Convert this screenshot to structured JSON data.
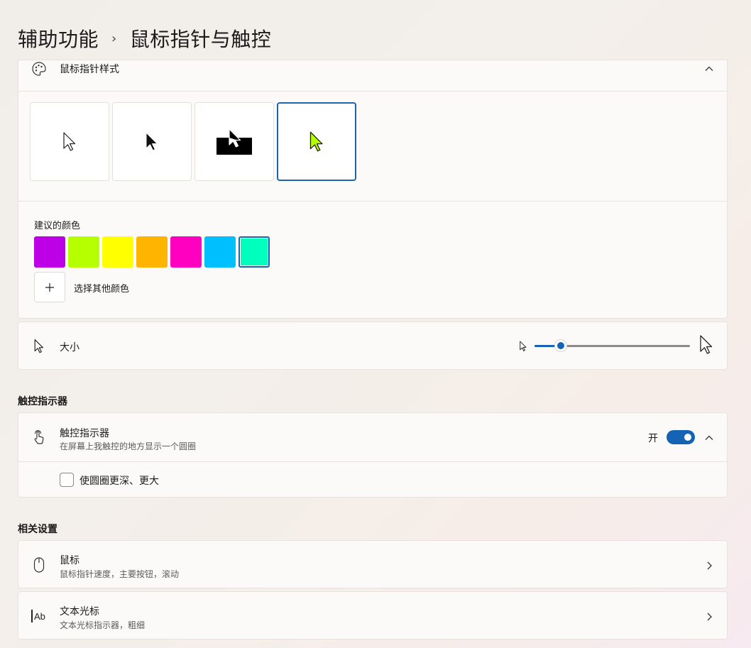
{
  "breadcrumb": {
    "parent": "辅助功能",
    "separator": "›",
    "current": "鼠标指针与触控"
  },
  "pointer_style": {
    "title": "鼠标指针样式",
    "styles": [
      "white",
      "black",
      "inverted",
      "custom"
    ],
    "selected_style": "custom",
    "custom_color": "#b6ff00"
  },
  "colors": {
    "label": "建议的颜色",
    "swatches": [
      "#bd00e6",
      "#b6ff00",
      "#ffff00",
      "#ffb400",
      "#ff00c1",
      "#00bfff",
      "#00ffbd"
    ],
    "selected_index": 6,
    "other_label": "选择其他颜色"
  },
  "size": {
    "title": "大小",
    "value_fraction": 0.17
  },
  "touch_section_heading": "触控指示器",
  "touch": {
    "title": "触控指示器",
    "subtitle": "在屏幕上我触控的地方显示一个圆圈",
    "state_label": "开",
    "on": true,
    "checkbox_label": "使圆圈更深、更大",
    "checkbox_checked": false
  },
  "related_heading": "相关设置",
  "related": [
    {
      "title": "鼠标",
      "subtitle": "鼠标指针速度，主要按钮，滚动",
      "icon": "mouse-icon"
    },
    {
      "title": "文本光标",
      "subtitle": "文本光标指示器，粗细",
      "icon": "text-cursor-icon"
    }
  ]
}
